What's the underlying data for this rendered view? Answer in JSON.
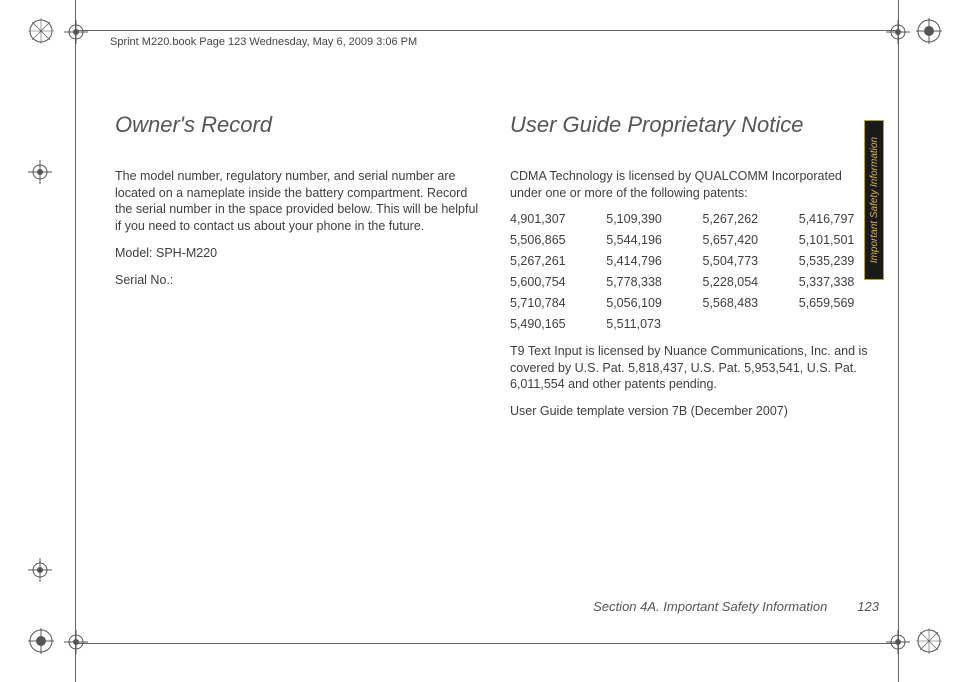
{
  "header": {
    "running_head": "Sprint M220.book  Page 123  Wednesday, May 6, 2009  3:06 PM"
  },
  "left_column": {
    "heading": "Owner's Record",
    "body1": "The model number, regulatory number, and serial number are located on a nameplate inside the battery compartment. Record the serial number in the space provided below. This will be helpful if you need to contact us about your phone in the future.",
    "model_line": "Model:  SPH-M220",
    "serial_line": "Serial No.:"
  },
  "right_column": {
    "heading": "User Guide Proprietary Notice",
    "intro": "CDMA Technology is licensed by QUALCOMM Incorporated under one or more of the following patents:",
    "patents": [
      [
        "4,901,307",
        "5,109,390",
        "5,267,262",
        "5,416,797"
      ],
      [
        "5,506,865",
        "5,544,196",
        "5,657,420",
        "5,101,501"
      ],
      [
        "5,267,261",
        "5,414,796",
        "5,504,773",
        "5,535,239"
      ],
      [
        "5,600,754",
        "5,778,338",
        "5,228,054",
        "5,337,338"
      ],
      [
        "5,710,784",
        "5,056,109",
        "5,568,483",
        "5,659,569"
      ],
      [
        "5,490,165",
        "5,511,073",
        "",
        ""
      ]
    ],
    "t9_notice": "T9 Text Input is licensed by Nuance Communications, Inc. and is covered by U.S. Pat. 5,818,437, U.S. Pat. 5,953,541, U.S. Pat. 6,011,554 and other patents pending.",
    "template_line": "User Guide template version 7B (December 2007)"
  },
  "footer": {
    "section_label": "Section 4A. Important Safety Information",
    "page_number": "123"
  },
  "side_tab": {
    "label": "Important Safety Information"
  }
}
